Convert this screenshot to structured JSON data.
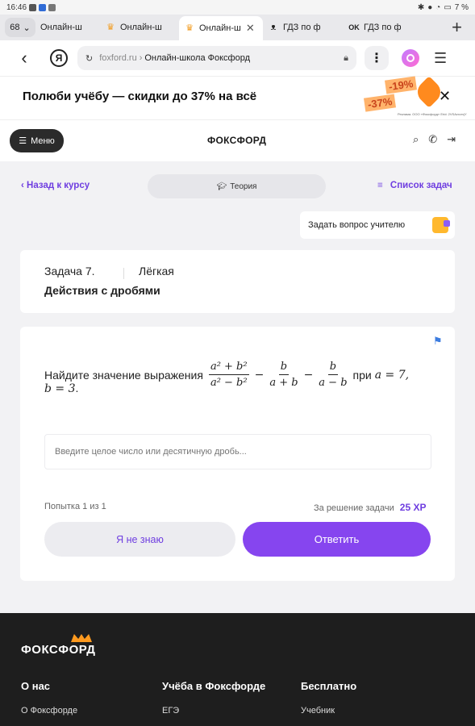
{
  "status_bar": {
    "time": "16:46",
    "battery": "7 %"
  },
  "tabs": {
    "count": "68",
    "items": [
      {
        "label": "Онлайн-ш",
        "favicon": "",
        "active": false
      },
      {
        "label": "Онлайн-ш",
        "favicon": "foxford-crown",
        "active": false
      },
      {
        "label": "Онлайн-ш",
        "favicon": "foxford-crown",
        "active": true
      },
      {
        "label": "ГДЗ по ф",
        "favicon": "gdz-owl",
        "active": false
      },
      {
        "label": "ГДЗ по ф",
        "favicon": "ok",
        "active": false
      }
    ],
    "new_tab": "+"
  },
  "address_bar": {
    "domain": "foxford.ru",
    "page_title": "Онлайн-школа Фоксфорд"
  },
  "promo": {
    "text": "Полюби учёбу — скидки до 37% на всё",
    "badge_1": "-19%",
    "badge_2": "-37%",
    "legal": "Реклама. ООО «Фоксфорд» Erid: 2VSAvxcrvjY"
  },
  "site_header": {
    "menu_label": "Меню",
    "logo": "ФОКСФОРД"
  },
  "nav": {
    "back_label": "Назад к курсу",
    "theory_label": "Теория",
    "tasks_label": "Список задач"
  },
  "ask_teacher": {
    "label": "Задать вопрос учителю"
  },
  "task": {
    "number": "Задача 7.",
    "level": "Лёгкая",
    "topic": "Действия с дробями"
  },
  "question": {
    "prefix": "Найдите значение выражения",
    "f1_num": "a² + b²",
    "f1_den": "a² − b²",
    "f2_num": "b",
    "f2_den": "a + b",
    "f3_num": "b",
    "f3_den": "a − b",
    "minus": "−",
    "at": "при",
    "cond_a": "a = 7,",
    "cond_b": "b = 3",
    "end": "."
  },
  "answer": {
    "placeholder": "Введите целое число или десятичную дробь..."
  },
  "attempt": "Попытка 1 из 1",
  "reward": {
    "label": "За решение задачи",
    "xp": "25 XP"
  },
  "buttons": {
    "dont_know": "Я не знаю",
    "submit": "Ответить"
  },
  "footer": {
    "logo": "ФОКСФОРД",
    "columns": [
      {
        "title": "О нас",
        "link": "О Фоксфорде"
      },
      {
        "title": "Учёба в Фоксфорде",
        "link": "ЕГЭ"
      },
      {
        "title": "Бесплатно",
        "link": "Учебник"
      }
    ]
  },
  "colors": {
    "accent": "#8645ef",
    "link": "#6f3ee0",
    "footer_bg": "#1e1e1e"
  }
}
